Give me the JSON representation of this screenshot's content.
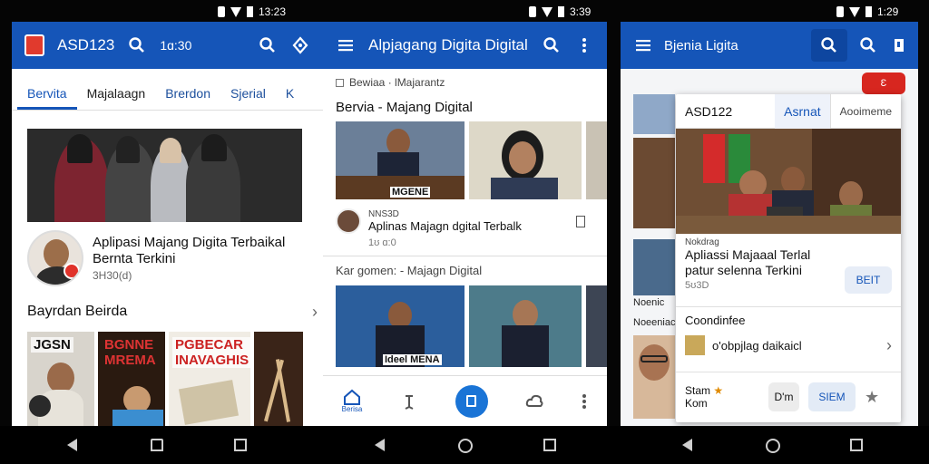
{
  "status_bar": {
    "time_left": "13:23",
    "time_mid": "3:39",
    "time_right": "1:29"
  },
  "screen1": {
    "app_title": "ASD123",
    "header_text": "1ɑ:30",
    "tabs": [
      "Bervita",
      "Majalaagn",
      "Brerdon",
      "Sjerial",
      "K"
    ],
    "card": {
      "headline_line1": "Aplipasi Majang Digita Terbaikal",
      "headline_line2": "Bernta Terkini",
      "meta": "3H30(d)"
    },
    "section_title": "Bayrdan Beirda",
    "thumb_labels": [
      "JGSN",
      "BGNNE MREMA",
      "PGBECAR INAVAGHIS"
    ]
  },
  "screen2": {
    "app_title": "Alpjagang Digita Digital",
    "crumb": "Bewiaa · lMajarantz",
    "section_title": "Bervia - Majang Digital",
    "image_caption": "MGENE",
    "card_kicker": "NNS3D",
    "card_headline": "Aplinas Majagn dgital Terbalk",
    "card_meta": "1ʊ ɑ:0",
    "subhead": "Kar gomen: - Majagn Digital",
    "caption2": "Ideel MENA",
    "nav_label": "Berisa"
  },
  "screen3": {
    "app_title": "Bjenia Ligita",
    "red_pill": "Ɛ",
    "popup_tabs": [
      "ASD122",
      "Asrnat",
      "Aooimeme"
    ],
    "kicker": "Nokdrag",
    "headline_line1": "Apliassi Majaaal Terlal",
    "headline_line2": "patur selenna Terkini",
    "meta": "5ʊ3D",
    "button": "BEIT",
    "row1": "Coondinfee",
    "row2": "o'obpjlag daikaicl",
    "chip_label": "Stam ",
    "chip_sub": "Kom",
    "chip_a": "D'm",
    "chip_b": "SIEM",
    "side_text_1": "Noenic",
    "side_text_2": "Noeeniac"
  },
  "colors": {
    "brand_blue": "#1555b8",
    "accent_red": "#d7261f",
    "background": "#f2f3f5"
  }
}
